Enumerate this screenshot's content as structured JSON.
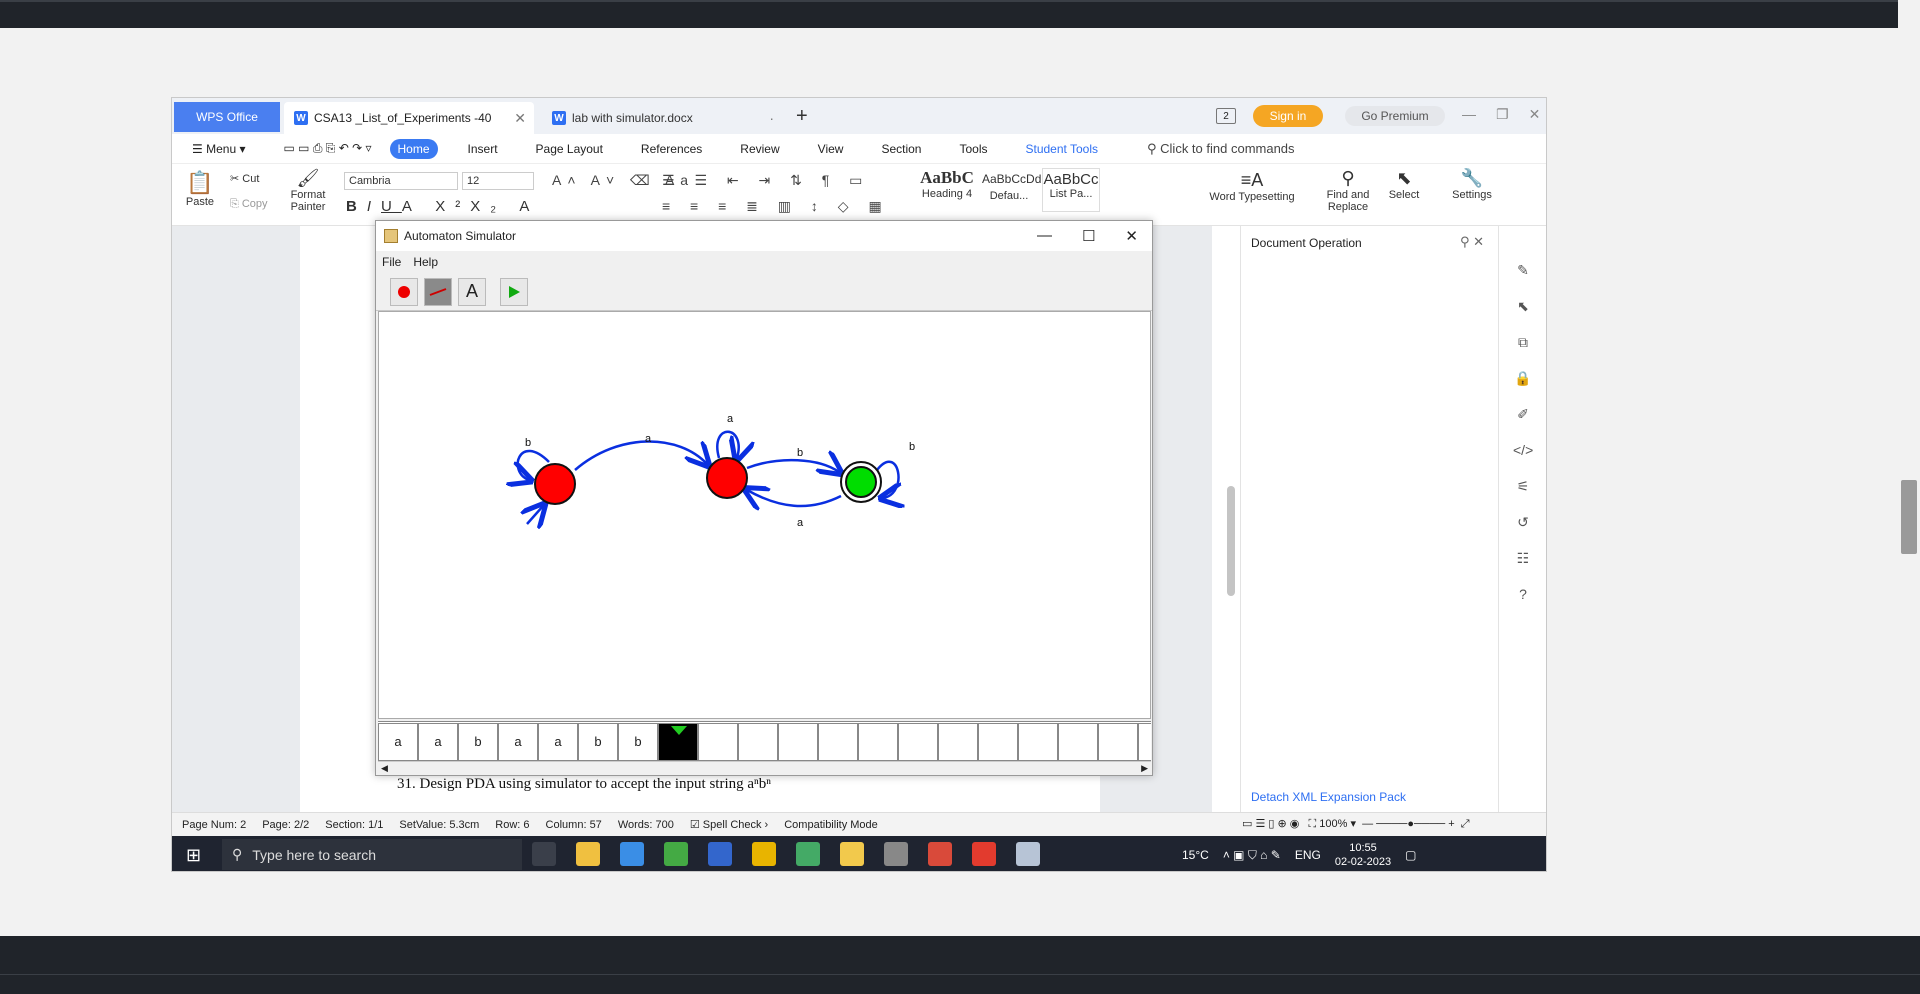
{
  "wps": {
    "brand_tab": "WPS Office",
    "tabs": [
      {
        "label": "CSA13 _List_of_Experiments -40"
      },
      {
        "label": "lab with simulator.docx"
      }
    ],
    "badge_count": "2",
    "sign_in": "Sign in",
    "premium": "Go Premium"
  },
  "menubar": {
    "menu": "Menu",
    "items": [
      "Home",
      "Insert",
      "Page Layout",
      "References",
      "Review",
      "View",
      "Section",
      "Tools",
      "Student Tools"
    ],
    "search_placeholder": "Click to find commands"
  },
  "ribbon": {
    "paste": "Paste",
    "cut": "Cut",
    "copy": "Copy",
    "format_painter": "Format Painter",
    "font_name": "Cambria",
    "font_size": "12",
    "styles": [
      {
        "sample": "AaBbC",
        "name": "Heading 4"
      },
      {
        "sample": "AaBbCcDd",
        "name": "Defau..."
      },
      {
        "sample": "AaBbCc",
        "name": "List Pa..."
      }
    ],
    "word_typesetting": "Word Typesetting",
    "find_replace": "Find and Replace",
    "select": "Select",
    "settings": "Settings"
  },
  "document": {
    "line": "31.  Design PDA using simulator to accept the input string  aⁿbⁿ"
  },
  "doc_operation": {
    "title": "Document Operation",
    "footer": "Detach XML Expansion Pack"
  },
  "statusbar": {
    "page_num": "Page Num: 2",
    "page": "Page: 2/2",
    "section": "Section: 1/1",
    "setvalue": "SetValue: 5.3cm",
    "row": "Row: 6",
    "column": "Column: 57",
    "words": "Words: 700",
    "spell_check": "Spell Check",
    "compat": "Compatibility Mode",
    "zoom": "100%"
  },
  "taskbar": {
    "search_placeholder": "Type here to search",
    "temperature": "15°C",
    "language": "ENG",
    "time": "10:55",
    "date": "02-02-2023"
  },
  "automaton": {
    "title": "Automaton Simulator",
    "menu": [
      "File",
      "Help"
    ],
    "states": [
      {
        "id": "q0",
        "accepting": false,
        "start": true,
        "color": "#ff0000"
      },
      {
        "id": "q1",
        "accepting": false,
        "start": false,
        "color": "#ff0000"
      },
      {
        "id": "q2",
        "accepting": true,
        "start": false,
        "color": "#00dd00"
      }
    ],
    "transitions": [
      {
        "from": "q0",
        "to": "q0",
        "label": "b"
      },
      {
        "from": "q0",
        "to": "q1",
        "label": "a"
      },
      {
        "from": "q1",
        "to": "q1",
        "label": "a"
      },
      {
        "from": "q1",
        "to": "q2",
        "label": "b"
      },
      {
        "from": "q2",
        "to": "q1",
        "label": "a"
      },
      {
        "from": "q2",
        "to": "q2",
        "label": "b"
      }
    ],
    "tape": [
      "a",
      "a",
      "b",
      "a",
      "a",
      "b",
      "b",
      "",
      "",
      "",
      "",
      "",
      "",
      "",
      "",
      "",
      "",
      "",
      "",
      ""
    ],
    "head_index": 7,
    "edge_color": "#0a2fe0"
  }
}
